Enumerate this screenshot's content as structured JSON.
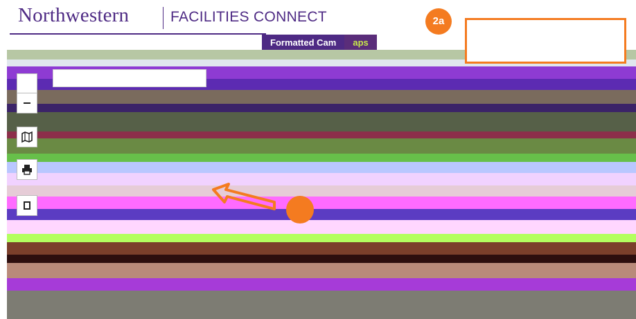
{
  "header": {
    "brand": "Northwestern",
    "product": "FACILITIES CONNECT"
  },
  "nav": {
    "tab_campus": "Formatted Cam",
    "tab_maps": "aps"
  },
  "callout": {
    "badge": "2a",
    "color": "#f47b20"
  },
  "map": {
    "controls": [
      {
        "name": "zoom-out",
        "icon": "minus-icon"
      },
      {
        "name": "map-view",
        "icon": "map-icon"
      },
      {
        "name": "print",
        "icon": "printer-icon"
      },
      {
        "name": "bookmark",
        "icon": "bookmark-icon"
      }
    ]
  },
  "colors": {
    "brand_purple": "#4e2a84",
    "accent_orange": "#f47b20"
  }
}
